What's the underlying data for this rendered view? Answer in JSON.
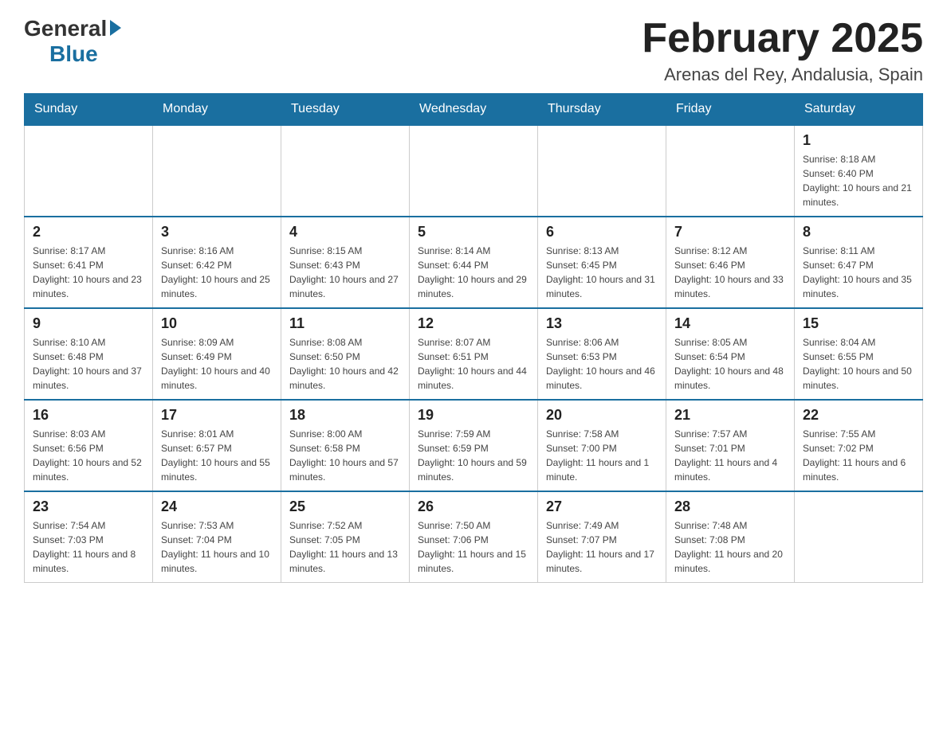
{
  "header": {
    "logo_general": "General",
    "logo_blue": "Blue",
    "title": "February 2025",
    "subtitle": "Arenas del Rey, Andalusia, Spain"
  },
  "weekdays": [
    "Sunday",
    "Monday",
    "Tuesday",
    "Wednesday",
    "Thursday",
    "Friday",
    "Saturday"
  ],
  "weeks": [
    [
      {
        "day": "",
        "info": ""
      },
      {
        "day": "",
        "info": ""
      },
      {
        "day": "",
        "info": ""
      },
      {
        "day": "",
        "info": ""
      },
      {
        "day": "",
        "info": ""
      },
      {
        "day": "",
        "info": ""
      },
      {
        "day": "1",
        "info": "Sunrise: 8:18 AM\nSunset: 6:40 PM\nDaylight: 10 hours and 21 minutes."
      }
    ],
    [
      {
        "day": "2",
        "info": "Sunrise: 8:17 AM\nSunset: 6:41 PM\nDaylight: 10 hours and 23 minutes."
      },
      {
        "day": "3",
        "info": "Sunrise: 8:16 AM\nSunset: 6:42 PM\nDaylight: 10 hours and 25 minutes."
      },
      {
        "day": "4",
        "info": "Sunrise: 8:15 AM\nSunset: 6:43 PM\nDaylight: 10 hours and 27 minutes."
      },
      {
        "day": "5",
        "info": "Sunrise: 8:14 AM\nSunset: 6:44 PM\nDaylight: 10 hours and 29 minutes."
      },
      {
        "day": "6",
        "info": "Sunrise: 8:13 AM\nSunset: 6:45 PM\nDaylight: 10 hours and 31 minutes."
      },
      {
        "day": "7",
        "info": "Sunrise: 8:12 AM\nSunset: 6:46 PM\nDaylight: 10 hours and 33 minutes."
      },
      {
        "day": "8",
        "info": "Sunrise: 8:11 AM\nSunset: 6:47 PM\nDaylight: 10 hours and 35 minutes."
      }
    ],
    [
      {
        "day": "9",
        "info": "Sunrise: 8:10 AM\nSunset: 6:48 PM\nDaylight: 10 hours and 37 minutes."
      },
      {
        "day": "10",
        "info": "Sunrise: 8:09 AM\nSunset: 6:49 PM\nDaylight: 10 hours and 40 minutes."
      },
      {
        "day": "11",
        "info": "Sunrise: 8:08 AM\nSunset: 6:50 PM\nDaylight: 10 hours and 42 minutes."
      },
      {
        "day": "12",
        "info": "Sunrise: 8:07 AM\nSunset: 6:51 PM\nDaylight: 10 hours and 44 minutes."
      },
      {
        "day": "13",
        "info": "Sunrise: 8:06 AM\nSunset: 6:53 PM\nDaylight: 10 hours and 46 minutes."
      },
      {
        "day": "14",
        "info": "Sunrise: 8:05 AM\nSunset: 6:54 PM\nDaylight: 10 hours and 48 minutes."
      },
      {
        "day": "15",
        "info": "Sunrise: 8:04 AM\nSunset: 6:55 PM\nDaylight: 10 hours and 50 minutes."
      }
    ],
    [
      {
        "day": "16",
        "info": "Sunrise: 8:03 AM\nSunset: 6:56 PM\nDaylight: 10 hours and 52 minutes."
      },
      {
        "day": "17",
        "info": "Sunrise: 8:01 AM\nSunset: 6:57 PM\nDaylight: 10 hours and 55 minutes."
      },
      {
        "day": "18",
        "info": "Sunrise: 8:00 AM\nSunset: 6:58 PM\nDaylight: 10 hours and 57 minutes."
      },
      {
        "day": "19",
        "info": "Sunrise: 7:59 AM\nSunset: 6:59 PM\nDaylight: 10 hours and 59 minutes."
      },
      {
        "day": "20",
        "info": "Sunrise: 7:58 AM\nSunset: 7:00 PM\nDaylight: 11 hours and 1 minute."
      },
      {
        "day": "21",
        "info": "Sunrise: 7:57 AM\nSunset: 7:01 PM\nDaylight: 11 hours and 4 minutes."
      },
      {
        "day": "22",
        "info": "Sunrise: 7:55 AM\nSunset: 7:02 PM\nDaylight: 11 hours and 6 minutes."
      }
    ],
    [
      {
        "day": "23",
        "info": "Sunrise: 7:54 AM\nSunset: 7:03 PM\nDaylight: 11 hours and 8 minutes."
      },
      {
        "day": "24",
        "info": "Sunrise: 7:53 AM\nSunset: 7:04 PM\nDaylight: 11 hours and 10 minutes."
      },
      {
        "day": "25",
        "info": "Sunrise: 7:52 AM\nSunset: 7:05 PM\nDaylight: 11 hours and 13 minutes."
      },
      {
        "day": "26",
        "info": "Sunrise: 7:50 AM\nSunset: 7:06 PM\nDaylight: 11 hours and 15 minutes."
      },
      {
        "day": "27",
        "info": "Sunrise: 7:49 AM\nSunset: 7:07 PM\nDaylight: 11 hours and 17 minutes."
      },
      {
        "day": "28",
        "info": "Sunrise: 7:48 AM\nSunset: 7:08 PM\nDaylight: 11 hours and 20 minutes."
      },
      {
        "day": "",
        "info": ""
      }
    ]
  ]
}
